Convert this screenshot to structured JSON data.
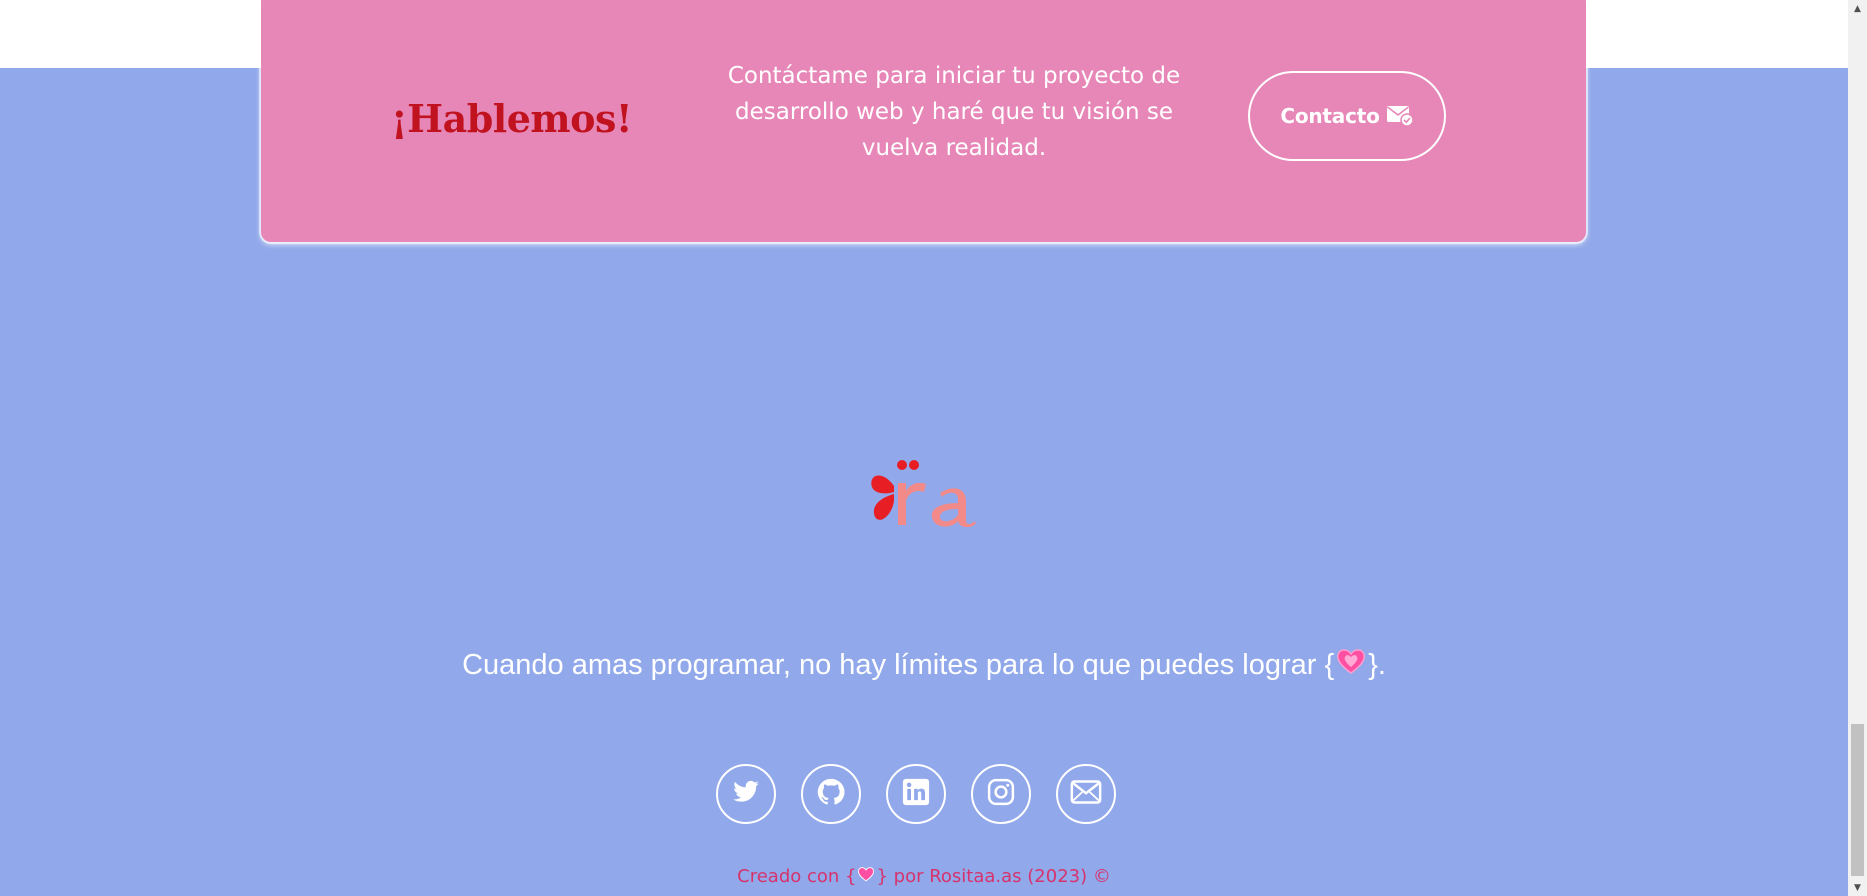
{
  "cta": {
    "title": "¡Hablemos!",
    "text": "Contáctame para iniciar tu proyecto de desarrollo web y haré que tu visión se vuelva realidad.",
    "button_label": "Contacto"
  },
  "logo": {
    "icon": "ra-butterfly-logo"
  },
  "tagline": {
    "before": "Cuando amas programar, no hay límites para lo que puedes lograr {",
    "after": "}."
  },
  "social": [
    {
      "icon": "twitter-icon"
    },
    {
      "icon": "github-icon"
    },
    {
      "icon": "linkedin-icon"
    },
    {
      "icon": "instagram-icon"
    },
    {
      "icon": "mail-icon"
    }
  ],
  "credit": {
    "before": "Creado con {",
    "after": "} por Rositaa.as (2023) ©"
  },
  "colors": {
    "footer_bg": "#91a8ea",
    "card_bg": "#e787b8",
    "title_red": "#c1121f",
    "credit_pink": "#d6336c",
    "heart_pink": "#ff4fa3"
  }
}
